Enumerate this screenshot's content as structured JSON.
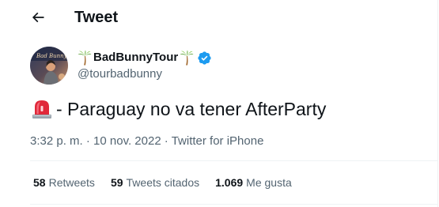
{
  "header": {
    "title": "Tweet",
    "back_icon": "arrow-left-icon"
  },
  "author": {
    "display_name": "BadBunnyTour",
    "handle": "@tourbadbunny",
    "verified": true,
    "name_decoration_icon": "palm-tree-icon",
    "verified_icon": "verified-badge-icon",
    "verified_color": "#1d9bf0"
  },
  "tweet": {
    "leading_icon": "rotating-light-icon",
    "text": "- Paraguay no va tener AfterParty"
  },
  "meta": {
    "time": "3:32 p. m.",
    "separator": "·",
    "date": "10 nov. 2022",
    "source": "Twitter for iPhone"
  },
  "stats": [
    {
      "count": "58",
      "label": "Retweets"
    },
    {
      "count": "59",
      "label": "Tweets citados"
    },
    {
      "count": "1.069",
      "label": "Me gusta"
    }
  ],
  "colors": {
    "text_primary": "#0f1419",
    "text_secondary": "#536471",
    "divider": "#eff3f4",
    "accent": "#1d9bf0"
  }
}
